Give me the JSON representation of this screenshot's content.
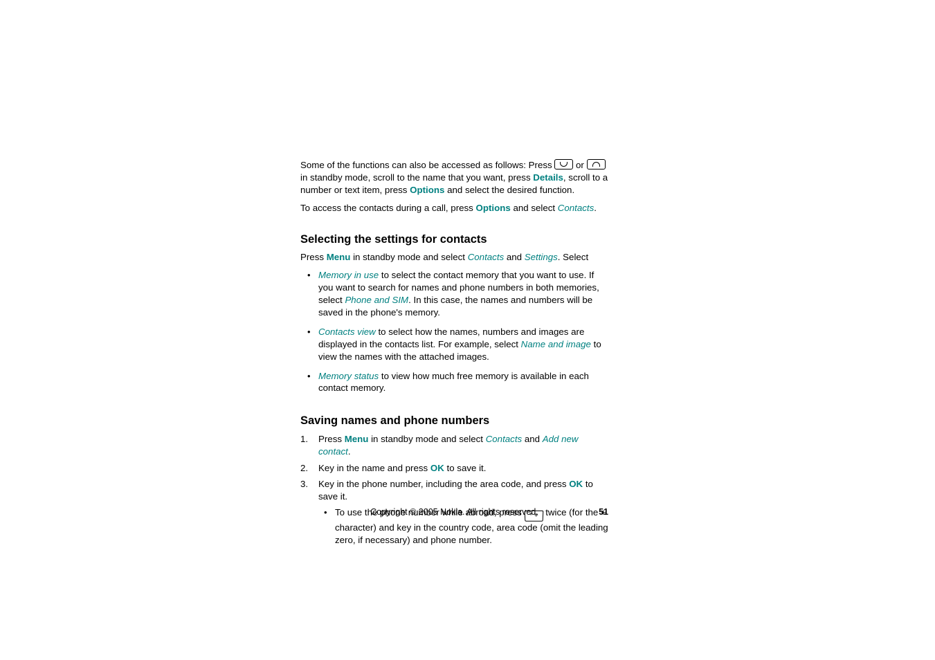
{
  "para1": {
    "a": "Some of the functions can also be accessed as follows: Press ",
    "b": " or ",
    "c": " in standby mode, scroll to the name that you want, press ",
    "details": "Details",
    "d": ", scroll to a number or text item, press ",
    "options": "Options",
    "e": " and select the desired function."
  },
  "para2": {
    "a": "To access the contacts during a call, press ",
    "options": "Options",
    "b": " and select ",
    "contacts": "Contacts",
    "c": "."
  },
  "h_settings": "Selecting the settings for contacts",
  "para3": {
    "a": "Press ",
    "menu": "Menu",
    "b": " in standby mode and select ",
    "contacts": "Contacts",
    "c": " and ",
    "settings": "Settings",
    "d": ". Select"
  },
  "b1": {
    "mem": "Memory in use",
    "a": " to select the contact memory that you want to use. If you want to search for names and phone numbers in both memories, select ",
    "psim": "Phone and SIM",
    "b": ". In this case, the names and numbers will be saved in the phone's memory."
  },
  "b2": {
    "cv": "Contacts view",
    "a": " to select how the names, numbers and images are displayed in the contacts list. For example, select ",
    "ni": "Name and image",
    "b": " to view the names with the attached images."
  },
  "b3": {
    "ms": "Memory status",
    "a": " to view how much free memory is available in each contact memory."
  },
  "h_saving": "Saving names and phone numbers",
  "s1": {
    "n": "1.",
    "a": "Press ",
    "menu": "Menu",
    "b": " in standby mode and select ",
    "contacts": "Contacts",
    "c": " and ",
    "add": "Add new contact",
    "d": "."
  },
  "s2": {
    "n": "2.",
    "a": "Key in the name and press ",
    "ok": "OK",
    "b": " to save it."
  },
  "s3": {
    "n": "3.",
    "a": "Key in the phone number, including the area code, and press ",
    "ok": "OK",
    "b": " to save it."
  },
  "s3sub": {
    "a": "To use the phone number while abroad, press ",
    "star": "* +",
    "b": " twice (for the + character) and key in the country code, area code (omit the leading zero, if necessary) and phone number."
  },
  "footer": {
    "cp": "Copyright © 2005 Nokia. All rights reserved.",
    "pg": "51"
  }
}
